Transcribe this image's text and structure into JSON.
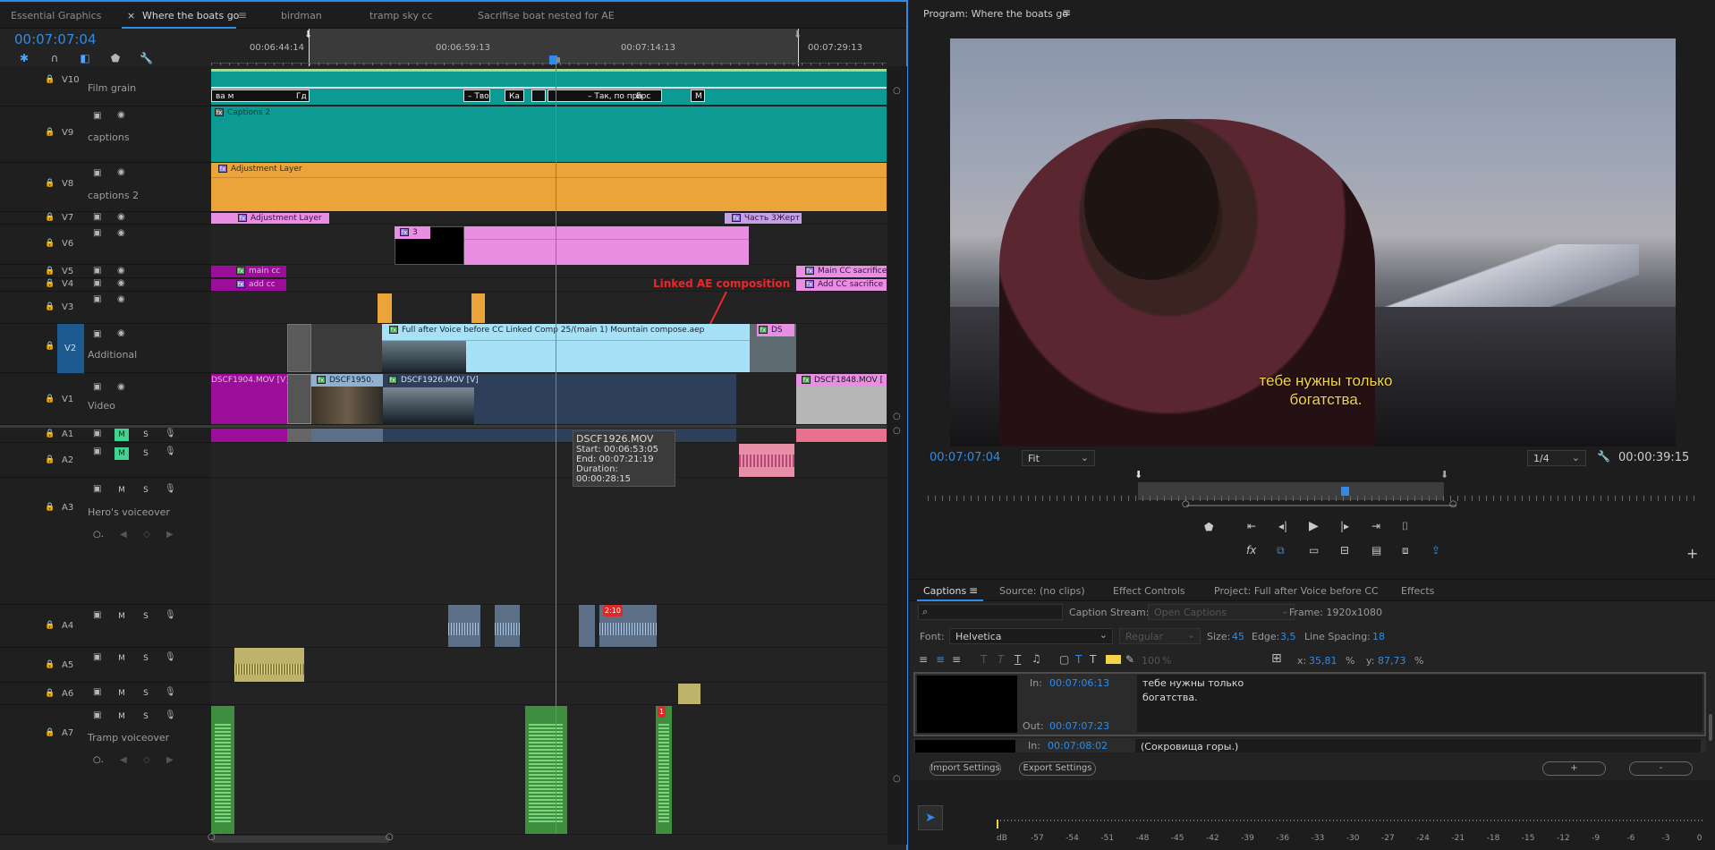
{
  "timeline": {
    "tabs": [
      "Essential Graphics",
      "Where the boats go",
      "birdman",
      "tramp sky cc",
      "Sacrifise boat nested for AE"
    ],
    "active_tab": "Where the boats go",
    "timecode": "00:07:07:04",
    "ruler_labels": [
      "00:06:44:14",
      "00:06:59:13",
      "00:07:14:13",
      "00:07:29:13"
    ],
    "tracks": {
      "v10": {
        "name": "V10",
        "label": "Film grain"
      },
      "v9": {
        "name": "V9",
        "label": "captions"
      },
      "v8": {
        "name": "V8",
        "label": "captions 2"
      },
      "v7": {
        "name": "V7"
      },
      "v6": {
        "name": "V6"
      },
      "v5": {
        "name": "V5"
      },
      "v4": {
        "name": "V4"
      },
      "v3": {
        "name": "V3"
      },
      "v2": {
        "name": "V2",
        "label": "Additional"
      },
      "v1": {
        "name": "V1",
        "label": "Video"
      },
      "a1": {
        "name": "A1"
      },
      "a2": {
        "name": "A2"
      },
      "a3": {
        "name": "A3",
        "label": "Hero's voiceover"
      },
      "a4": {
        "name": "A4"
      },
      "a5": {
        "name": "A5"
      },
      "a6": {
        "name": "A6"
      },
      "a7": {
        "name": "A7",
        "label": "Tramp voiceover"
      }
    },
    "mute": "M",
    "solo": "S",
    "clips": {
      "captions2": "Captions 2",
      "adj1": "Adjustment Layer",
      "adj2": "Adjustment Layer",
      "part3": "Часть 3Жерт",
      "v6clip": "3",
      "mainc": "main cc",
      "addc": "add cc",
      "maincc_s": "Main CC sacrifice",
      "addcc_s": "Add CC sacrifice",
      "linked": "Full after Voice before CC Linked Comp 25/(main 1) Mountain compose.aep",
      "ds": "DS",
      "v1a": "DSCF1904.MOV [V]",
      "v1b": "DSCF1950.",
      "v1c": "DSCF1926.MOV [V]",
      "v1d": "DSCF1848.MOV [",
      "grain1": "ва м",
      "grain2": "Гд",
      "grain3": "– Тво",
      "grain4": "Ка",
      "grain5": "– Так, по пра",
      "grain6": "Ерс",
      "grain7": "М",
      "badge": "2:10",
      "badge2": "1"
    },
    "annotation": "Linked AE composition",
    "tooltip": {
      "name": "DSCF1926.MOV",
      "start": "Start: 00:06:53:05",
      "end": "End: 00:07:21:19",
      "duration": "Duration: 00:00:28:15"
    }
  },
  "program": {
    "title": "Program: Where the boats go",
    "subtitle_line1": "тебе нужны только",
    "subtitle_line2": "богатства.",
    "timecode": "00:07:07:04",
    "fit": "Fit",
    "resolution": "1/4",
    "duration": "00:00:39:15"
  },
  "captions_panel": {
    "tabs": [
      "Captions",
      "Source: (no clips)",
      "Effect Controls",
      "Project: Full after Voice before CC",
      "Effects"
    ],
    "stream_label": "Caption Stream:",
    "stream_value": "Open Captions",
    "frame": "Frame:  1920x1080",
    "font_label": "Font:",
    "font_value": "Helvetica",
    "style_value": "Regular",
    "size_label": "Size:",
    "size_value": "45",
    "edge_label": "Edge:",
    "edge_value": "3,5",
    "spacing_label": "Line Spacing:",
    "spacing_value": "18",
    "opacity": "100",
    "pct": "%",
    "x_label": "x:",
    "x_value": "35,81",
    "y_label": "y:",
    "y_value": "87,73",
    "in_label": "In:",
    "out_label": "Out:",
    "cap1": {
      "in": "00:07:06:13",
      "out": "00:07:07:23",
      "text1": "тебе нужны только",
      "text2": "богатства."
    },
    "cap2": {
      "in": "00:07:08:02",
      "text": "(Сокровища горы.)"
    },
    "import": "Import Settings",
    "export": "Export Settings",
    "plus": "+",
    "minus": "-"
  },
  "meter": {
    "unit": "dB",
    "labels": [
      "-57",
      "-54",
      "-51",
      "-48",
      "-45",
      "-42",
      "-39",
      "-36",
      "-33",
      "-30",
      "-27",
      "-24",
      "-21",
      "-18",
      "-15",
      "-12",
      "-9",
      "-6",
      "-3",
      "0"
    ]
  },
  "colors": {
    "accent": "#2d8ceb",
    "teal": "#0d9a93",
    "orange": "#eba43a",
    "pink": "#e88fe3",
    "purple": "#9a0e9a",
    "lightblue": "#a6e1f7",
    "navy": "#2e3f5a",
    "green": "#3fd491"
  }
}
